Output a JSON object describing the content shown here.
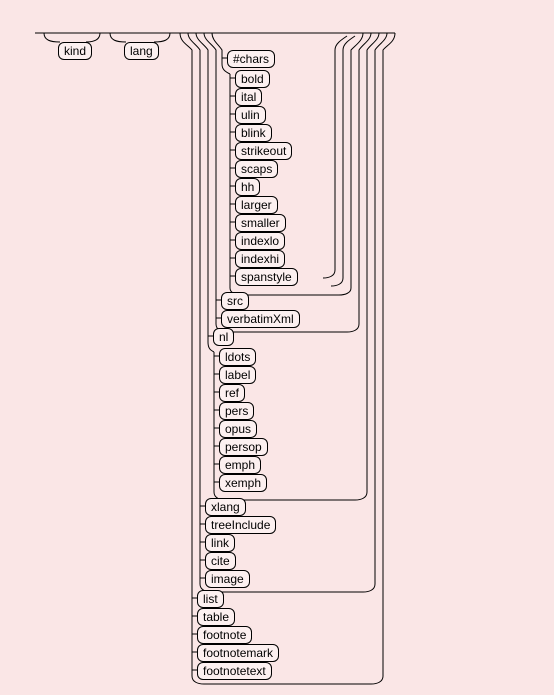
{
  "nodes": {
    "kind": "kind",
    "lang": "lang",
    "chars": "#chars",
    "bold": "bold",
    "ital": "ital",
    "ulin": "ulin",
    "blink": "blink",
    "strikeout": "strikeout",
    "scaps": "scaps",
    "hh": "hh",
    "larger": "larger",
    "smaller": "smaller",
    "indexlo": "indexlo",
    "indexhi": "indexhi",
    "spanstyle": "spanstyle",
    "src": "src",
    "verbatimxml": "verbatimXml",
    "nl": "nl",
    "ldots": "ldots",
    "label": "label",
    "ref": "ref",
    "pers": "pers",
    "opus": "opus",
    "persop": "persop",
    "emph": "emph",
    "xemph": "xemph",
    "xlang": "xlang",
    "treeinclude": "treeInclude",
    "link": "link",
    "cite": "cite",
    "image": "image",
    "list": "list",
    "table": "table",
    "footnote": "footnote",
    "footnotemark": "footnotemark",
    "footnotetext": "footnotetext"
  }
}
